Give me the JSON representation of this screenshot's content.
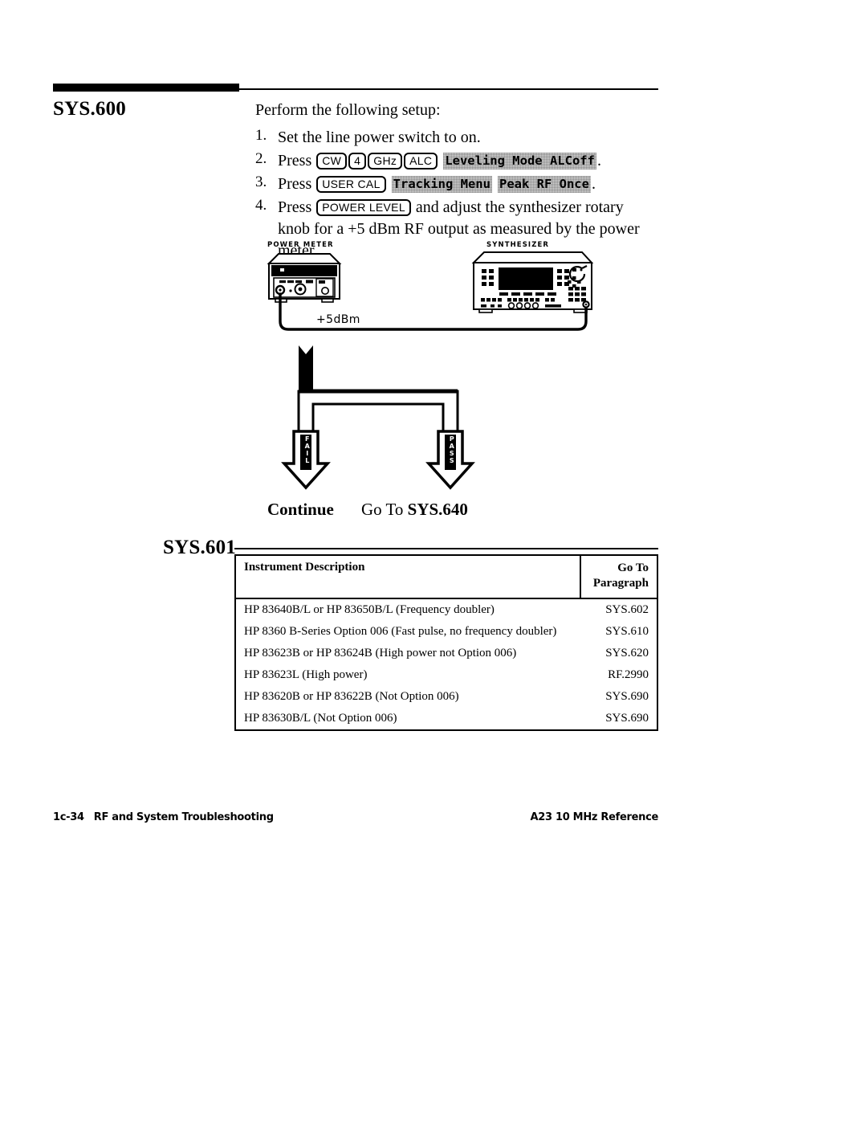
{
  "header": {
    "section_id": "SYS.600"
  },
  "intro": {
    "text": "Perform the following setup:"
  },
  "steps": [
    {
      "num": "1.",
      "prefix": "Set the line power switch to on.",
      "hardkeys": [],
      "softkeys": [],
      "suffix": ""
    },
    {
      "num": "2.",
      "prefix": "Press",
      "hardkeys": [
        "CW",
        "4",
        "GHz",
        "ALC"
      ],
      "softkeys": [
        "Leveling Mode ALCoff"
      ],
      "suffix": "."
    },
    {
      "num": "3.",
      "prefix": "Press",
      "hardkeys": [
        "USER CAL"
      ],
      "softkeys": [
        "Tracking Menu",
        "Peak RF Once"
      ],
      "suffix": "."
    },
    {
      "num": "4.",
      "prefix": "Press",
      "hardkeys": [
        "POWER LEVEL"
      ],
      "softkeys": [],
      "suffix": "and adjust the synthesizer rotary knob for a +5 dBm RF output as measured by the power meter."
    }
  ],
  "diagram": {
    "power_meter_label": "POWER METER",
    "synthesizer_label": "SYNTHESIZER",
    "cable_label": "+5dBm"
  },
  "flow": {
    "fail_label": "FAIL",
    "pass_label": "PASS",
    "fail_action": "Continue",
    "pass_action_prefix": "Go To ",
    "pass_action_target": "SYS.640"
  },
  "table_section": {
    "section_id": "SYS.601",
    "columns": [
      "Instrument Description",
      "Go To Paragraph"
    ],
    "column_header_line1": "Go To",
    "column_header_line2": "Paragraph",
    "rows": [
      {
        "description": "HP 83640B/L or HP 83650B/L (Frequency doubler)",
        "goto": "SYS.602"
      },
      {
        "description": "HP 8360 B-Series Option 006 (Fast pulse, no frequency doubler)",
        "goto": "SYS.610"
      },
      {
        "description": "HP 83623B or HP 83624B (High power not Option 006)",
        "goto": "SYS.620"
      },
      {
        "description": "HP 83623L (High power)",
        "goto": "RF.2990"
      },
      {
        "description": "HP 83620B or HP 83622B (Not Option 006)",
        "goto": "SYS.690"
      },
      {
        "description": "HP 83630B/L (Not Option 006)",
        "goto": "SYS.690"
      }
    ]
  },
  "footer": {
    "page_number": "1c-34",
    "left_title": "RF and System Troubleshooting",
    "right_title": "A23 10 MHz Reference"
  },
  "colors": {
    "ink": "#000000",
    "paper": "#ffffff",
    "softkey_fill": "#d8d8d8"
  }
}
